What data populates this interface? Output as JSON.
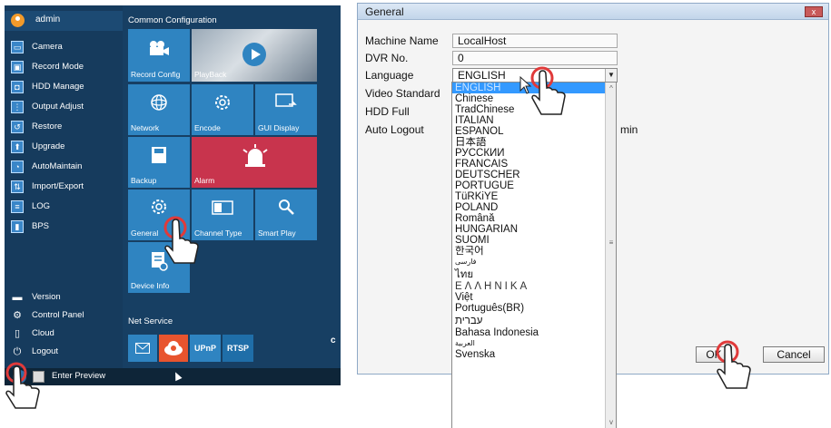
{
  "left_panel": {
    "user": "admin",
    "menu": [
      {
        "label": "Camera",
        "icon": "camera-icon",
        "glyph": "▭"
      },
      {
        "label": "Record Mode",
        "icon": "record-mode-icon",
        "glyph": "▣"
      },
      {
        "label": "HDD Manage",
        "icon": "hdd-icon",
        "glyph": "◘"
      },
      {
        "label": "Output Adjust",
        "icon": "output-adjust-icon",
        "glyph": "⋮"
      },
      {
        "label": "Restore",
        "icon": "restore-icon",
        "glyph": "↺"
      },
      {
        "label": "Upgrade",
        "icon": "upgrade-icon",
        "glyph": "⬆"
      },
      {
        "label": "AutoMaintain",
        "icon": "automaintain-icon",
        "glyph": "◔"
      },
      {
        "label": "Import/Export",
        "icon": "import-export-icon",
        "glyph": "⇅"
      },
      {
        "label": "LOG",
        "icon": "log-icon",
        "glyph": "≡"
      },
      {
        "label": "BPS",
        "icon": "bps-icon",
        "glyph": "▮"
      }
    ],
    "bottom": [
      {
        "label": "Version",
        "icon": "version-icon",
        "glyph": "▬"
      },
      {
        "label": "Control Panel",
        "icon": "control-panel-icon",
        "glyph": "⚙"
      },
      {
        "label": "Cloud",
        "icon": "cloud-icon",
        "glyph": "▯"
      },
      {
        "label": "Logout",
        "icon": "logout-icon",
        "glyph": "⏻"
      }
    ],
    "common_config_title": "Common Configuration",
    "tiles": {
      "record_config": "Record Config",
      "playback": "PlayBack",
      "network": "Network",
      "encode": "Encode",
      "gui_display": "GUI Display",
      "backup": "Backup",
      "alarm": "Alarm",
      "general": "General",
      "channel_type": "Channel Type",
      "smart_play": "Smart Play",
      "device_info": "Device Info"
    },
    "net_service_title": "Net Service",
    "net_service": {
      "upnp": "UPnP",
      "rtsp": "RTSP"
    },
    "side_letter": "c",
    "taskbar": {
      "enter_preview": "Enter Preview"
    },
    "colors": {
      "panel": "#173f63",
      "tile": "#2f84c1",
      "alarm": "#c8344d",
      "highlight": "#e03a3a"
    }
  },
  "dialog": {
    "title": "General",
    "close": "x",
    "machine_name_label": "Machine Name",
    "machine_name_value": "LocalHost",
    "dvr_no_label": "DVR No.",
    "dvr_no_value": "0",
    "language_label": "Language",
    "language_value": "ENGLISH",
    "video_standard_label": "Video Standard",
    "hdd_full_label": "HDD Full",
    "auto_logout_label": "Auto Logout",
    "auto_logout_unit": "min",
    "language_options": [
      "ENGLISH",
      "Chinese",
      "TradChinese",
      "ITALIAN",
      "ESPAÑOL",
      "日本語",
      "РУССКИЙ",
      "FRANCAIS",
      "DEUTSCHER",
      "PORTUGUÊ",
      "TüRKiYE",
      "POLAND",
      "Română",
      "HUNGARIAN",
      "SUOMI",
      "한국어",
      "فارسی",
      "ไทย",
      "ΕΛΛΗΝΙΚΑ",
      "Việt",
      "Português(BR)",
      "עברית",
      "Bahasa Indonesia",
      "العربية",
      "Svenska"
    ],
    "ok_button": "OK",
    "cancel_button": "Cancel"
  }
}
